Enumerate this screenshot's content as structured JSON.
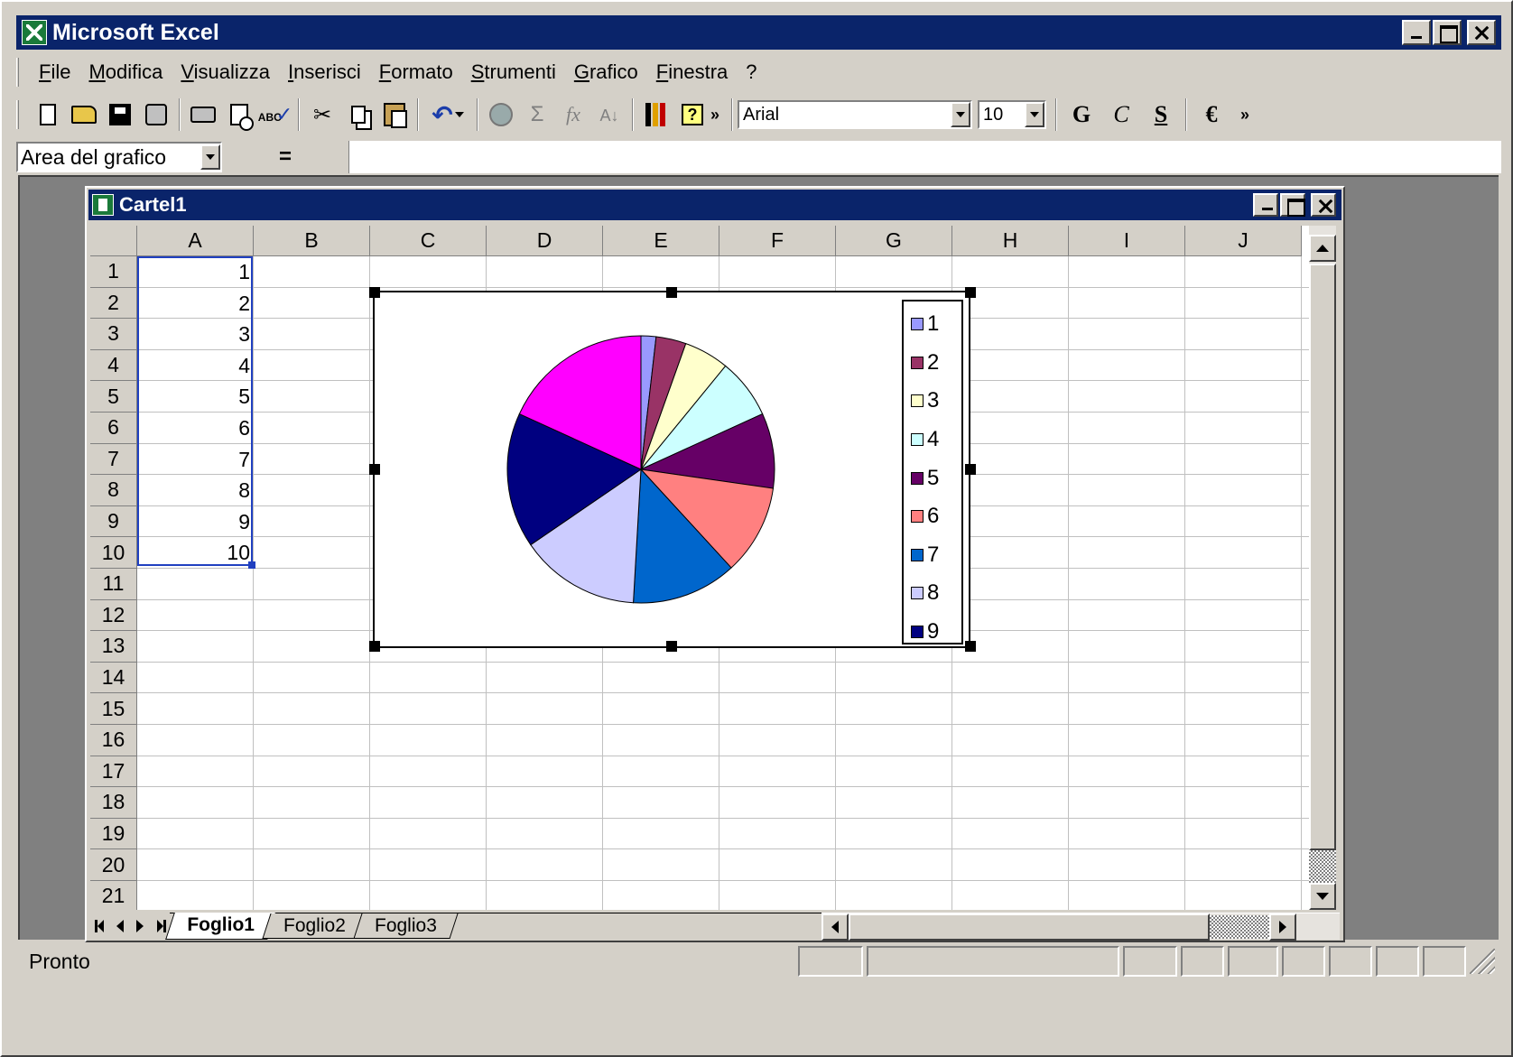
{
  "app": {
    "title": "Microsoft Excel"
  },
  "menu": [
    "File",
    "Modifica",
    "Visualizza",
    "Inserisci",
    "Formato",
    "Strumenti",
    "Grafico",
    "Finestra",
    "?"
  ],
  "toolbar": {
    "font_name": "Arial",
    "font_size": "10",
    "bold_label": "G",
    "italic_label": "C",
    "underline_label": "S",
    "euro_label": "€",
    "spell_label": "ABC",
    "help_label": "?",
    "icons": [
      "new-icon",
      "open-icon",
      "save-icon",
      "permission-icon",
      "print-icon",
      "print-preview-icon",
      "spelling-icon",
      "cut-icon",
      "copy-icon",
      "paste-icon",
      "undo-icon",
      "hyperlink-icon",
      "autosum-icon",
      "function-icon",
      "sort-icon",
      "chart-wizard-icon",
      "help-icon"
    ]
  },
  "formula_bar": {
    "name_box": "Area del grafico",
    "equals": "=",
    "value": ""
  },
  "workbook": {
    "title": "Cartel1",
    "columns": [
      "A",
      "B",
      "C",
      "D",
      "E",
      "F",
      "G",
      "H",
      "I",
      "J"
    ],
    "rows": [
      "1",
      "2",
      "3",
      "4",
      "5",
      "6",
      "7",
      "8",
      "9",
      "10",
      "11",
      "12",
      "13",
      "14",
      "15",
      "16",
      "17",
      "18",
      "19",
      "20",
      "21"
    ],
    "column_a_values": [
      "1",
      "2",
      "3",
      "4",
      "5",
      "6",
      "7",
      "8",
      "9",
      "10"
    ],
    "sheets": [
      "Foglio1",
      "Foglio2",
      "Foglio3"
    ],
    "active_sheet": "Foglio1"
  },
  "chart_data": {
    "type": "pie",
    "values": [
      1,
      2,
      3,
      4,
      5,
      6,
      7,
      8,
      9,
      10
    ],
    "legend": [
      "1",
      "2",
      "3",
      "4",
      "5",
      "6",
      "7",
      "8",
      "9"
    ],
    "legend_position": "right",
    "colors": [
      "#9999ff",
      "#993366",
      "#ffffcc",
      "#ccffff",
      "#660066",
      "#ff8080",
      "#0066cc",
      "#ccccff",
      "#000080",
      "#ff00ff"
    ],
    "title": ""
  },
  "status": {
    "text": "Pronto"
  }
}
